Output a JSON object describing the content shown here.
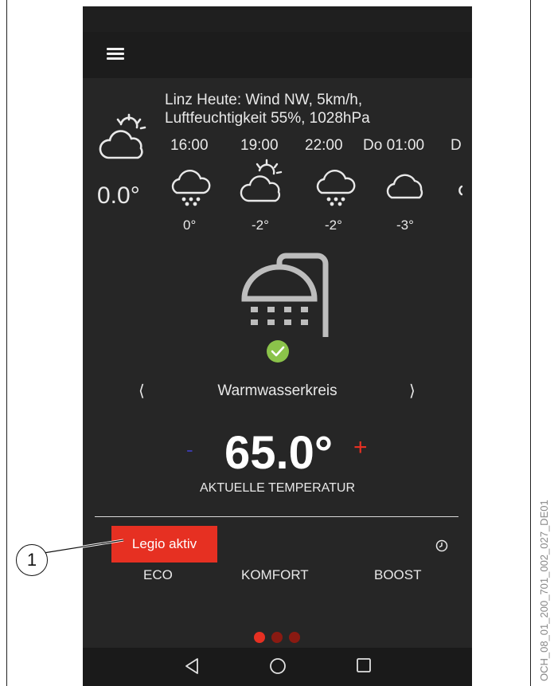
{
  "weather": {
    "line1": "Linz Heute: Wind NW, 5km/h,",
    "line2": "Luftfeuchtigkeit 55%, 1028hPa",
    "current_temp": "0.0°",
    "current_icon": "partly-cloudy-icon",
    "forecast": [
      {
        "time": "16:00",
        "icon": "snow-cloud-icon",
        "temp": "0°"
      },
      {
        "time": "19:00",
        "icon": "partly-cloudy-icon",
        "temp": "-2°"
      },
      {
        "time": "22:00",
        "icon": "snow-cloud-icon",
        "temp": "-2°"
      },
      {
        "time": "Do 01:00",
        "icon": "cloud-icon",
        "temp": "-3°"
      },
      {
        "time": "D",
        "icon": "cloud-icon",
        "temp": ""
      }
    ]
  },
  "circuit": {
    "name": "Warmwasserkreis",
    "prev": "⟨",
    "next": "⟩"
  },
  "temperature": {
    "minus": "-",
    "value": "65.0°",
    "plus": "+",
    "label": "AKTUELLE TEMPERATUR"
  },
  "legio_label": "Legio aktiv",
  "modes": [
    "ECO",
    "KOMFORT",
    "BOOST"
  ],
  "page_dots": {
    "count": 3,
    "active": 0
  },
  "callout": {
    "number": "1"
  },
  "document_code": "OCH_08_01_200_701_002_027_DE01",
  "colors": {
    "background": "#262626",
    "accent_red": "#e63022",
    "minus_blue": "#3a3aa8",
    "check_green": "#8bc34a",
    "dot_inactive": "#8a1a12"
  }
}
